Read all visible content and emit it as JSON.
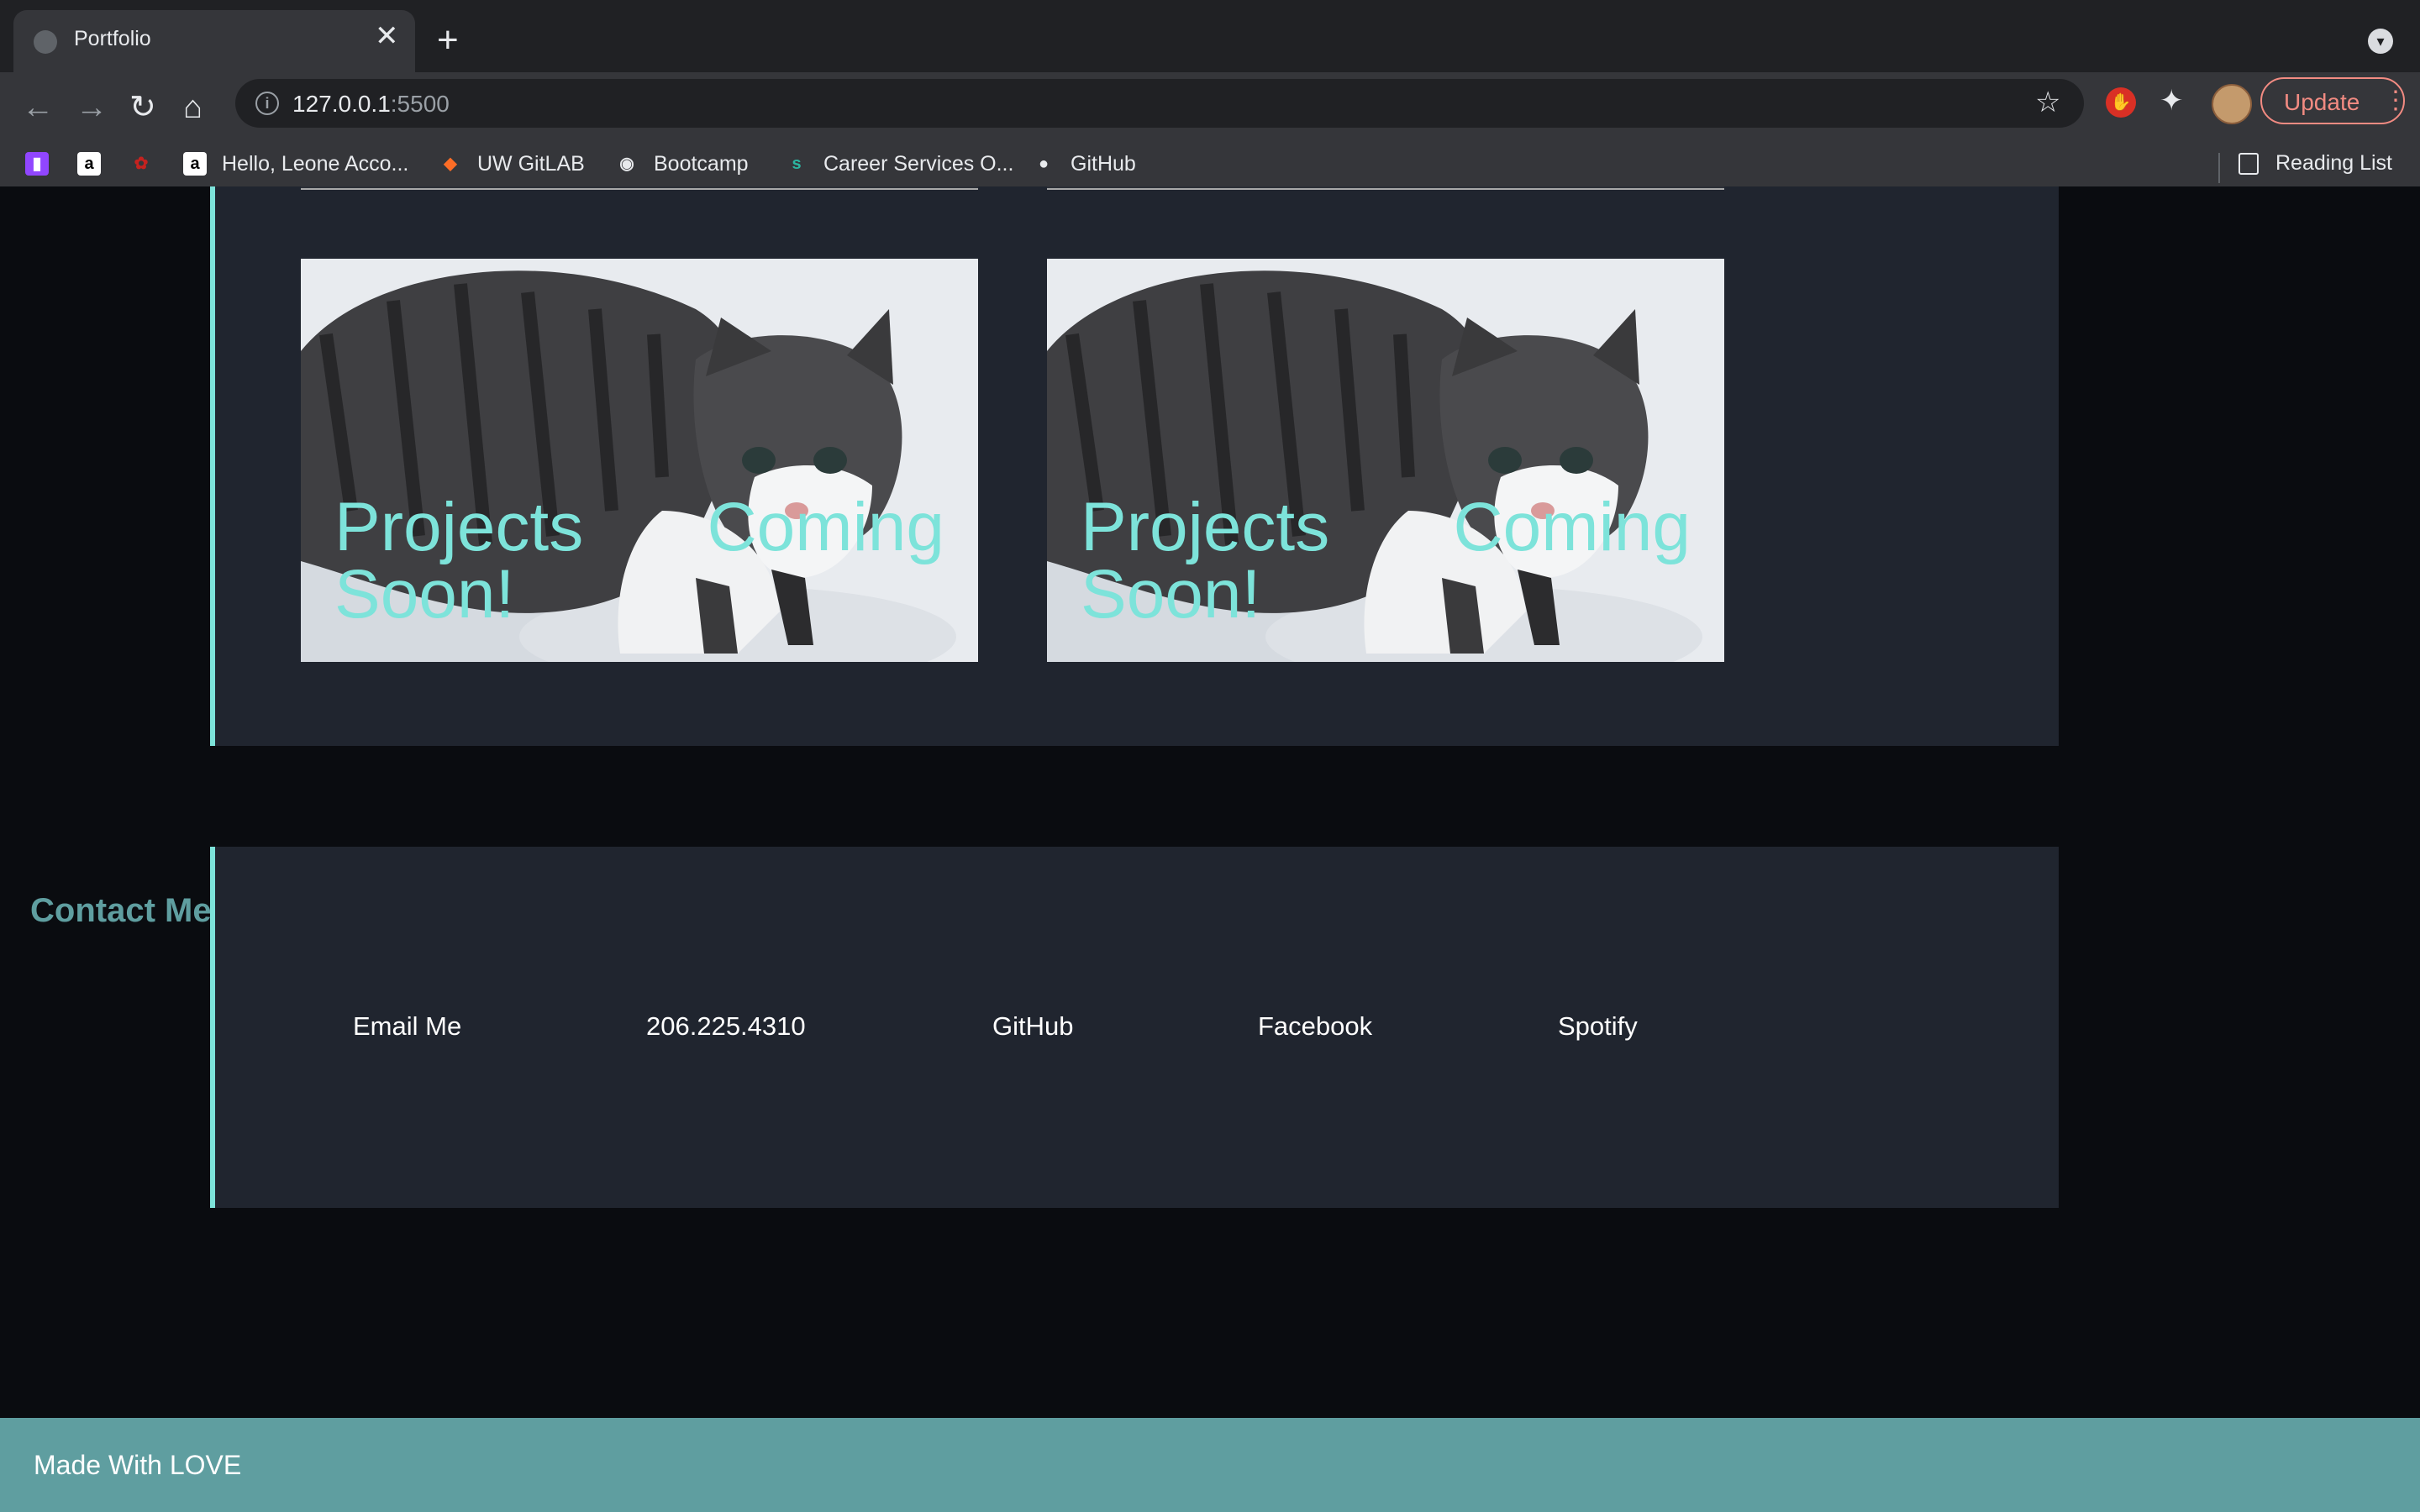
{
  "browser": {
    "tab_title": "Portfolio",
    "tab_close": "✕",
    "new_tab": "+",
    "tab_search": "▾",
    "nav": {
      "back": "←",
      "forward": "→",
      "reload": "↻",
      "home": "⌂"
    },
    "info": "i",
    "url_host": "127.0.0.1",
    "url_port": ":5500",
    "star": "☆",
    "update_label": "Update",
    "menu": "⋮",
    "bookmarks": [
      {
        "label": "",
        "icon": "twitch-icon",
        "color": "#9146ff",
        "glyph": "▮"
      },
      {
        "label": "",
        "icon": "amazon-icon",
        "color": "#ffffff",
        "glyph": "a"
      },
      {
        "label": "",
        "icon": "red-bookmark-icon",
        "color": "#c5221f",
        "glyph": "✿"
      },
      {
        "label": "Hello, Leone Acco...",
        "icon": "amazon-icon",
        "color": "#ffffff",
        "glyph": "a"
      },
      {
        "label": "UW GitLAB",
        "icon": "gitlab-icon",
        "color": "#fc6d26",
        "glyph": "◆"
      },
      {
        "label": "Bootcamp",
        "icon": "globe-icon",
        "color": "#e8eaed",
        "glyph": "◉"
      },
      {
        "label": "Career Services O...",
        "icon": "career-services-icon",
        "color": "#2bb5a0",
        "glyph": "s"
      },
      {
        "label": "GitHub",
        "icon": "github-icon",
        "color": "#e8eaed",
        "glyph": "●"
      }
    ],
    "reading_list": "Reading List"
  },
  "projects": {
    "cards": [
      {
        "title": "Projects Coming Soon!"
      },
      {
        "title": "Projects Coming Soon!"
      }
    ]
  },
  "contact": {
    "heading": "Contact Me",
    "links": [
      {
        "label": "Email Me"
      },
      {
        "label": "206.225.4310"
      },
      {
        "label": "GitHub"
      },
      {
        "label": "Facebook"
      },
      {
        "label": "Spotify"
      }
    ]
  },
  "footer": {
    "text": "Made With LOVE"
  },
  "colors": {
    "accent": "#7de3da",
    "panel": "#20252f",
    "background": "#0a0c10",
    "footer": "#5f9ea0"
  }
}
